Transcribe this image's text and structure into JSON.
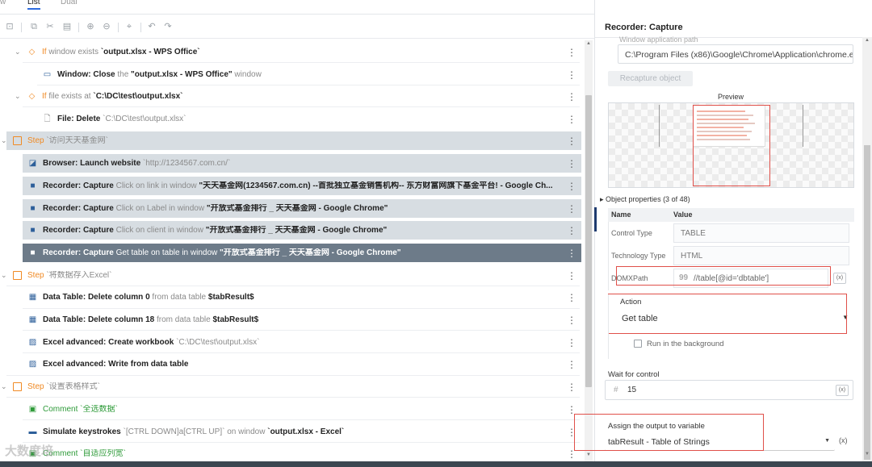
{
  "tabs": [
    "w",
    "List",
    "Dual"
  ],
  "toolbar": {
    "icons": [
      "breakpoint-icon",
      "copy-icon",
      "cut-icon",
      "paste-icon",
      "enable-icon",
      "disable-icon",
      "pin-icon",
      "undo-icon",
      "redo-icon"
    ]
  },
  "rows": [
    {
      "kind": "if",
      "text_prefix": "If",
      "text_mid": " window exists ",
      "text_value": "`output.xlsx - WPS Office`"
    },
    {
      "kind": "action",
      "title": "Window: Close",
      "text_mid": " the ",
      "text_value": "\"output.xlsx - WPS Office\"",
      "text_suffix": " window"
    },
    {
      "kind": "if",
      "text_prefix": "If",
      "text_mid": " file exists at ",
      "text_value": "`C:\\DC\\test\\output.xlsx`"
    },
    {
      "kind": "action",
      "title": "File: Delete",
      "text_value": " `C:\\DC\\test\\output.xlsx`"
    },
    {
      "kind": "step",
      "text_prefix": "Step",
      "text_value": " `访问天天基金网`"
    },
    {
      "kind": "action",
      "title": "Browser: Launch website",
      "text_value": " `http://1234567.com.cn/`"
    },
    {
      "kind": "action",
      "title": "Recorder: Capture",
      "text_mid": " Click on link in window ",
      "text_value": "\"天天基金网(1234567.com.cn) --首批独立基金销售机构-- 东方财富网旗下基金平台! - Google Ch..."
    },
    {
      "kind": "action",
      "title": "Recorder: Capture",
      "text_mid": " Click on Label in window ",
      "text_value": "\"开放式基金排行 _ 天天基金网 - Google Chrome\""
    },
    {
      "kind": "action",
      "title": "Recorder: Capture",
      "text_mid": " Click on client in window ",
      "text_value": "\"开放式基金排行 _ 天天基金网 - Google Chrome\""
    },
    {
      "kind": "action",
      "title": "Recorder: Capture",
      "text_mid": " Get table on table in window ",
      "text_value": "\"开放式基金排行 _ 天天基金网 - Google Chrome\""
    },
    {
      "kind": "step",
      "text_prefix": "Step",
      "text_value": " `将数据存入Excel`"
    },
    {
      "kind": "action",
      "title": "Data Table: Delete column 0",
      "text_mid": " from data table ",
      "text_value": "$tabResult$"
    },
    {
      "kind": "action",
      "title": "Data Table: Delete column 18",
      "text_mid": " from data table ",
      "text_value": "$tabResult$"
    },
    {
      "kind": "action",
      "title": "Excel advanced: Create workbook",
      "text_value": " `C:\\DC\\test\\output.xlsx`"
    },
    {
      "kind": "action",
      "title": "Excel advanced: Write from data table"
    },
    {
      "kind": "step",
      "text_prefix": "Step",
      "text_value": " `设置表格样式`"
    },
    {
      "kind": "comment",
      "text_prefix": "Comment",
      "text_value": " `全选数据`"
    },
    {
      "kind": "action",
      "title": "Simulate keystrokes",
      "text_mid": " `[CTRL DOWN]a[CTRL UP]` on window ",
      "text_value": "`output.xlsx - Excel`"
    },
    {
      "kind": "comment",
      "text_prefix": "Comment",
      "text_value": " `自适应列宽`"
    }
  ],
  "panel": {
    "title": "Recorder: Capture",
    "faded_label": "Window application path",
    "app_path": "C:\\Program Files (x86)\\Google\\Chrome\\Application\\chrome.exe",
    "recapture_label": "Recapture object",
    "preview_label": "Preview",
    "props_header": "Object properties (3 of 48)",
    "col_name": "Name",
    "col_value": "Value",
    "props": [
      {
        "name": "Control Type",
        "value": "TABLE"
      },
      {
        "name": "Technology Type",
        "value": "HTML"
      },
      {
        "name": "DOMXPath",
        "value": "//table[@id='dbtable']"
      }
    ],
    "action_label": "Action",
    "action_value": "Get table",
    "run_bg_label": "Run in the background",
    "wait_label": "Wait for control",
    "wait_value": "15",
    "assign_label": "Assign the output to variable",
    "assign_value": "tabResult - Table of Strings",
    "var_btn": "(x)",
    "hash": "#",
    "quote": "99"
  },
  "watermark": "大数度培"
}
